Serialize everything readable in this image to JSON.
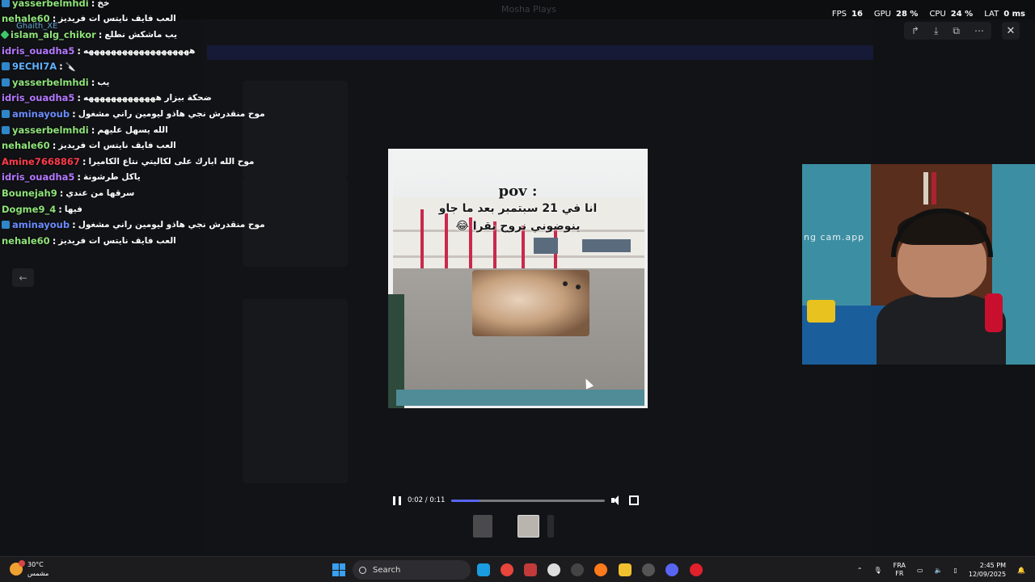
{
  "app": {
    "title": "Mosha Plays",
    "ghaith_label": "Ghaith_XE"
  },
  "stats": {
    "fps_label": "FPS",
    "fps_value": "16",
    "gpu_label": "GPU",
    "gpu_value": "28 %",
    "cpu_label": "CPU",
    "cpu_value": "24 %",
    "lat_label": "LAT",
    "lat_value": "0 ms"
  },
  "chat": [
    {
      "user": "yasserbelmhdi",
      "color": "#8fe37a",
      "badge": "prime",
      "msg": "خخ"
    },
    {
      "user": "nehale60",
      "color": "#8fe37a",
      "badge": "",
      "msg": "العب فايف نايتس ات فريديز"
    },
    {
      "user": "islam_alg_chikor",
      "color": "#8fe37a",
      "badge": "gem",
      "msg": "يب ماشكش نطلع"
    },
    {
      "user": "idris_ouadha5",
      "color": "#b478ff",
      "badge": "",
      "msg": "هههههههههههههههههههه"
    },
    {
      "user": "9ECHI7A",
      "color": "#5fb2ff",
      "badge": "prime",
      "msg": "🔪"
    },
    {
      "user": "yasserbelmhdi",
      "color": "#8fe37a",
      "badge": "prime",
      "msg": "يب"
    },
    {
      "user": "idris_ouadha5",
      "color": "#b478ff",
      "badge": "",
      "msg": "ضحكة بيزار هههههههههههههه"
    },
    {
      "user": "aminayoub",
      "color": "#6b8cff",
      "badge": "prime",
      "msg": "موح منقدرش نجي هاذو ليومين راني مشغول"
    },
    {
      "user": "yasserbelmhdi",
      "color": "#8fe37a",
      "badge": "prime",
      "msg": "الله يسهل عليهم"
    },
    {
      "user": "nehale60",
      "color": "#8fe37a",
      "badge": "",
      "msg": "العب فايف نايتس ات فريديز"
    },
    {
      "user": "Amine7668867",
      "color": "#ff3b4a",
      "badge": "",
      "msg": "موح الله ابارك على لكاليتي نتاع الكاميرا"
    },
    {
      "user": "idris_ouadha5",
      "color": "#b478ff",
      "badge": "",
      "msg": "ياكل طرشونة"
    },
    {
      "user": "Bounejah9",
      "color": "#8fe37a",
      "badge": "",
      "msg": "سرقها من عندي"
    },
    {
      "user": "Dogme9_4",
      "color": "#8fe37a",
      "badge": "",
      "msg": "فيها"
    },
    {
      "user": "aminayoub",
      "color": "#6b8cff",
      "badge": "prime",
      "msg": "موح منقدرش نجي هاذو ليومين راني مشغول"
    },
    {
      "user": "nehale60",
      "color": "#8fe37a",
      "badge": "",
      "msg": "العب فايف نايتس ات فريديز"
    }
  ],
  "video": {
    "pov": "pov :",
    "line1": "انا في 21 سبتمبر بعد ما جاو",
    "line2": "ينوضوني نروح نقرا 😂",
    "time": "0:02 / 0:11",
    "progress": 0.18
  },
  "webcam": {
    "overlay_text": "ng cam.app"
  },
  "taskbar": {
    "temperature": "30°C",
    "weather": "مشمس",
    "search": "Search",
    "lang1": "FRA",
    "lang2": "FR",
    "time": "2:45 PM",
    "date": "12/09/2025"
  }
}
